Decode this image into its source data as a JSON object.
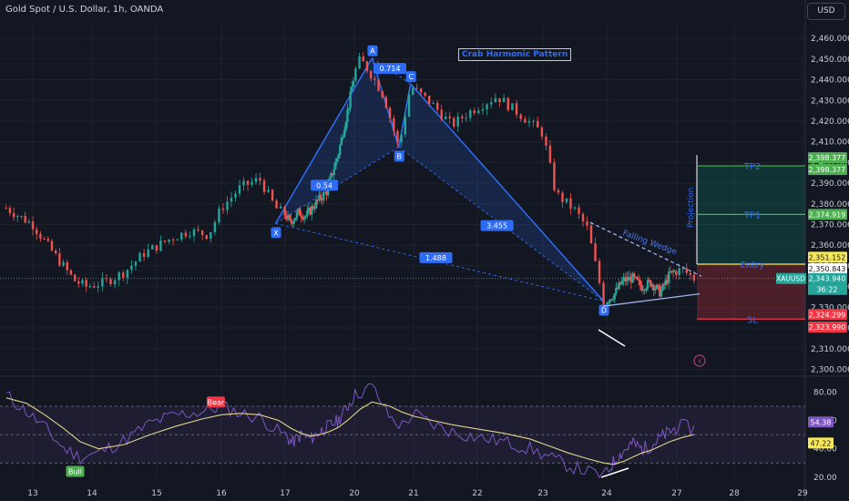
{
  "header": {
    "symbol_title": "Gold Spot / U.S. Dollar, 1h, OANDA",
    "currency": "USD"
  },
  "colors": {
    "bg": "#131722",
    "up": "#26a69a",
    "down": "#ef5350",
    "pattern": "#2f6cf6",
    "tp": "#4caf50",
    "entry": "#f7e859",
    "sl": "#f23645",
    "rsi": "#7e57c2",
    "rsi_ma": "#e3d48a"
  },
  "pattern_title": "Crab Harmonic Pattern",
  "pattern_points": [
    {
      "label": "X",
      "t": 16.85,
      "price": 2370.5
    },
    {
      "label": "A",
      "t": 20.3,
      "price": 2450.5
    },
    {
      "label": "B",
      "t": 20.75,
      "price": 2407.5
    },
    {
      "label": "C",
      "t": 20.95,
      "price": 2438.0
    },
    {
      "label": "D",
      "t": 23.95,
      "price": 2333.0
    }
  ],
  "pattern_ratios": [
    {
      "label": "0.54",
      "t": 18.7,
      "price": 2389.0
    },
    {
      "label": "0.714",
      "t": 20.6,
      "price": 2445.5
    },
    {
      "label": "3.455",
      "t": 22.3,
      "price": 2369.5
    },
    {
      "label": "1.488",
      "t": 21.35,
      "price": 2354.0
    }
  ],
  "wedge_label": "Falling Wedge",
  "projection_label": "Projection",
  "targets": {
    "tp2": {
      "label": "TP2",
      "price": 2398.377
    },
    "tp1": {
      "label": "TP1",
      "price": 2374.919
    },
    "entry": {
      "label": "Entry",
      "price": 2350.843
    },
    "sl": {
      "label": "SL",
      "price": 2324.299
    }
  },
  "price_tags": [
    {
      "text": "2,398.377",
      "price": 2398.377,
      "color": "#4caf50",
      "offset": -9
    },
    {
      "text": "2,398.377",
      "price": 2398.377,
      "color": "#4caf50",
      "offset": 4
    },
    {
      "text": "2,374.919",
      "price": 2374.919,
      "color": "#4caf50",
      "offset": 0
    },
    {
      "text": "2,351.152",
      "price": 2351.152,
      "color": "#f7e859",
      "offset": -7
    },
    {
      "text": "2,350.843",
      "price": 2350.843,
      "color": "#ffffff",
      "offset": 5
    },
    {
      "text": "2,343.940",
      "price": 2343.94,
      "color": "#26a69a",
      "offset": 0
    },
    {
      "text": "36:22",
      "price": 2343.94,
      "color": "#26a69a",
      "offset": 12
    },
    {
      "text": "2,324.299",
      "price": 2324.299,
      "color": "#f23645",
      "offset": -5
    },
    {
      "text": "2,323.990",
      "price": 2323.99,
      "color": "#f23645",
      "offset": 8
    }
  ],
  "symbol_tag": "XAUUSD",
  "rsi_tags": [
    {
      "text": "54.38",
      "value": 54.38,
      "color": "#7e57c2",
      "offset": -7
    },
    {
      "text": "47.22",
      "value": 47.22,
      "color": "#f7e859",
      "offset": 5
    }
  ],
  "signal_labels": [
    {
      "text": "Bear",
      "t": 15.9,
      "value": 73,
      "color": "#f23645"
    },
    {
      "text": "Bull",
      "t": 13.7,
      "value": 24,
      "color": "#4caf50"
    }
  ],
  "chart_data": {
    "type": "line",
    "title": "Gold Spot / U.S. Dollar, 1h, OANDA",
    "x_tick_labels": [
      "13",
      "14",
      "15",
      "16",
      "17",
      "20",
      "21",
      "22",
      "23",
      "24",
      "27",
      "28",
      "29"
    ],
    "y_ticks": [
      2300,
      2310,
      2320,
      2330,
      2340,
      2350,
      2360,
      2370,
      2380,
      2390,
      2400,
      2410,
      2420,
      2430,
      2440,
      2450,
      2460
    ],
    "y_tick_labels": [
      "2,300.000",
      "2,310.000",
      "2,320.000",
      "2,330.000",
      "2,340.000",
      "2,350.000",
      "2,360.000",
      "2,370.000",
      "2,380.000",
      "2,390.000",
      "2,400.000",
      "2,410.000",
      "2,420.000",
      "2,430.000",
      "2,440.000",
      "2,450.000",
      "2,460.000"
    ],
    "ylim": [
      2298,
      2468
    ],
    "series": [
      {
        "name": "XAUUSD",
        "x": [
          12.55,
          13.0,
          13.3,
          13.7,
          13.9,
          14.2,
          14.5,
          14.8,
          15.2,
          15.5,
          15.8,
          16.0,
          16.3,
          16.6,
          16.85,
          17.2,
          17.6,
          17.9,
          18.3,
          18.8,
          19.3,
          19.8,
          20.1,
          20.3,
          20.5,
          20.75,
          20.95,
          21.3,
          21.6,
          21.9,
          22.3,
          22.7,
          23.0,
          23.2,
          23.5,
          23.7,
          23.95,
          24.3,
          24.7,
          25.1,
          25.5,
          25.9,
          26.3,
          26.7,
          27.1,
          27.3
        ],
        "values": [
          2378,
          2370,
          2358,
          2343,
          2340,
          2342,
          2347,
          2356,
          2363,
          2367,
          2365,
          2378,
          2388,
          2392,
          2378,
          2371,
          2376,
          2374,
          2380,
          2386,
          2404,
          2430,
          2450,
          2442,
          2432,
          2407,
          2437,
          2428,
          2418,
          2425,
          2432,
          2422,
          2414,
          2385,
          2377,
          2368,
          2333,
          2336,
          2343,
          2344,
          2340,
          2342,
          2337,
          2346,
          2348,
          2344
        ]
      }
    ],
    "rsi": {
      "yticks": [
        20,
        40,
        60,
        80
      ],
      "ylim": [
        16,
        88
      ],
      "levels": [
        70,
        50,
        30
      ],
      "x": [
        12.55,
        12.9,
        13.2,
        13.5,
        13.8,
        14.1,
        14.5,
        14.9,
        15.3,
        15.7,
        16.0,
        16.3,
        16.6,
        16.9,
        17.3,
        17.7,
        18.1,
        18.5,
        18.9,
        19.3,
        19.7,
        20.1,
        20.3,
        20.6,
        20.8,
        21.0,
        21.3,
        21.6,
        22.0,
        22.4,
        22.8,
        23.1,
        23.4,
        23.7,
        23.95,
        24.3,
        24.7,
        25.1,
        25.5,
        25.9,
        26.3,
        26.7,
        27.1,
        27.3
      ],
      "values": [
        78,
        66,
        55,
        41,
        34,
        37,
        46,
        58,
        64,
        66,
        70,
        65,
        62,
        52,
        44,
        50,
        47,
        52,
        56,
        60,
        70,
        80,
        84,
        62,
        56,
        65,
        57,
        52,
        48,
        45,
        40,
        34,
        28,
        24,
        21,
        31,
        38,
        44,
        40,
        42,
        48,
        52,
        56,
        54
      ],
      "ma": [
        76,
        72,
        64,
        55,
        45,
        40,
        43,
        50,
        56,
        61,
        64,
        65,
        64,
        60,
        54,
        51,
        49,
        50,
        52,
        55,
        60,
        68,
        73,
        70,
        66,
        63,
        60,
        57,
        54,
        51,
        47,
        42,
        37,
        33,
        30,
        29,
        31,
        34,
        37,
        39,
        42,
        45,
        48,
        50
      ]
    }
  }
}
